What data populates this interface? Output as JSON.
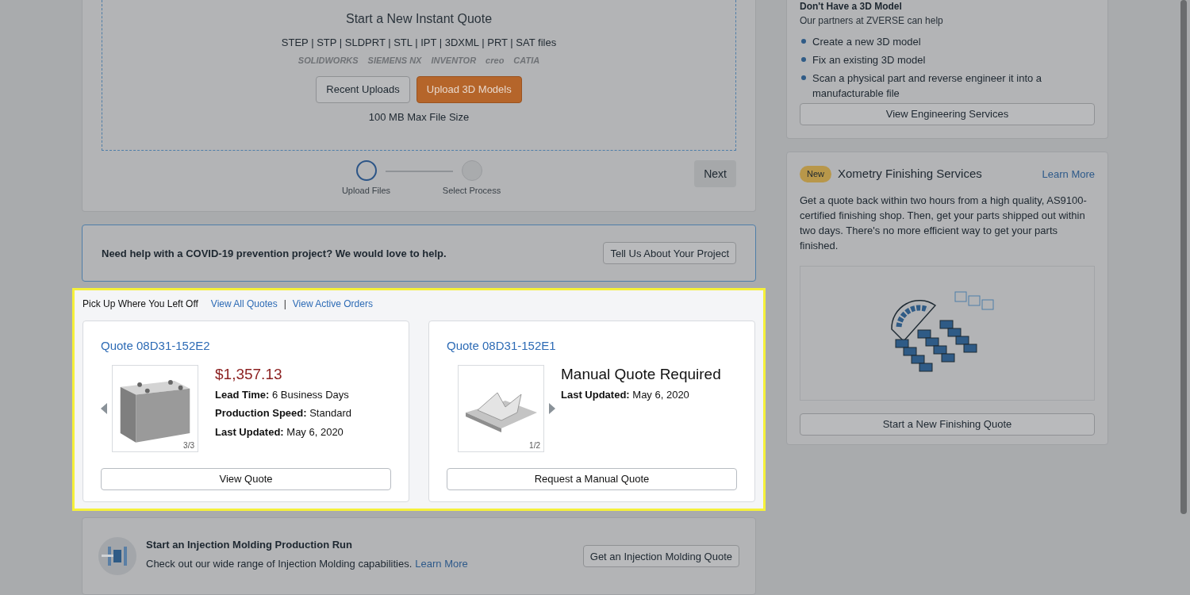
{
  "instant_quote": {
    "title": "Start a New Instant Quote",
    "formats": "STEP | STP | SLDPRT | STL | IPT | 3DXML | PRT | SAT files",
    "cad_logos": [
      "SOLIDWORKS",
      "SIEMENS NX",
      "INVENTOR",
      "creo",
      "CATIA"
    ],
    "buttons": [
      "Recent Uploads",
      "Upload 3D Models"
    ],
    "max_size": "100 MB Max File Size",
    "steps": [
      {
        "label": "Upload Files",
        "selected": true
      },
      {
        "label": "Select Process",
        "selected": false
      }
    ],
    "next_button": "Next"
  },
  "covid_banner": {
    "text": "Need help with a COVID-19 prevention project? We would love to help.",
    "button": "Tell Us About Your Project"
  },
  "recent": {
    "heading": "Pick Up Where You Left Off",
    "links": [
      "View All Quotes",
      "View Active Orders"
    ],
    "separator": "|",
    "quotes": [
      {
        "kind": "priced",
        "title": "Quote 08D31-152E2",
        "price": "$1,357.13",
        "details": [
          {
            "label": "Lead Time:",
            "value": "6 Business Days"
          },
          {
            "label": "Production Speed:",
            "value": "Standard"
          },
          {
            "label": "Last Updated:",
            "value": "May 6, 2020"
          }
        ],
        "counter": "3/3",
        "prev_arrow": true,
        "next_arrow": false,
        "button": "View Quote"
      },
      {
        "kind": "manual",
        "title": "Quote 08D31-152E1",
        "price": "Manual Quote Required",
        "details": [
          {
            "label": "Last Updated:",
            "value": "May 6, 2020"
          }
        ],
        "counter": "1/2",
        "prev_arrow": false,
        "next_arrow": true,
        "button": "Request a Manual Quote"
      }
    ]
  },
  "injection": {
    "title": "Start an Injection Molding Production Run",
    "text": "Check out our wide range of Injection Molding capabilities.",
    "link": "Learn More",
    "button": "Get an Injection Molding Quote"
  },
  "engineering": {
    "title": "Don't Have a 3D Model",
    "subtitle": "Our partners at ZVERSE can help",
    "items": [
      "Create a new 3D model",
      "Fix an existing 3D model",
      "Scan a physical part and reverse engineer it into a manufacturable file"
    ],
    "button": "View Engineering Services"
  },
  "finishing": {
    "badge": "New",
    "title": "Xometry Finishing Services",
    "link": "Learn More",
    "text": "Get a quote back within two hours from a high quality, AS9100-certified finishing shop. Then, get your parts shipped out within two days. There's no more efficient way to get your parts finished.",
    "button": "Start a New Finishing Quote"
  }
}
